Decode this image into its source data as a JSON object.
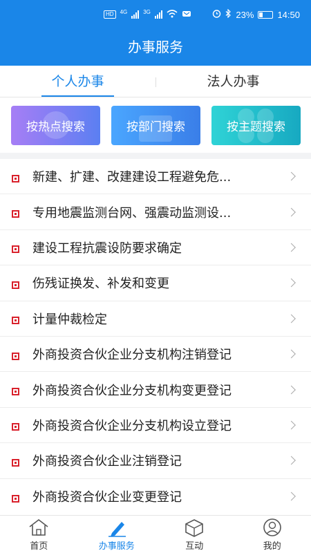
{
  "status_bar": {
    "hd_badge": "HD",
    "net_1": "4G",
    "net_2": "3G",
    "battery": "23%",
    "time": "14:50"
  },
  "header": {
    "title": "办事服务"
  },
  "tabs": [
    {
      "label": "个人办事",
      "active": true
    },
    {
      "label": "法人办事",
      "active": false
    }
  ],
  "search_buttons": {
    "hot": "按热点搜索",
    "dept": "按部门搜索",
    "topic": "按主题搜索"
  },
  "items": [
    "新建、扩建、改建建设工程避免危...",
    "专用地震监测台网、强震动监测设...",
    "建设工程抗震设防要求确定",
    "伤残证换发、补发和变更",
    "计量仲裁检定",
    "外商投资合伙企业分支机构注销登记",
    "外商投资合伙企业分支机构变更登记",
    "外商投资合伙企业分支机构设立登记",
    "外商投资合伙企业注销登记",
    "外商投资合伙企业变更登记"
  ],
  "nav": [
    {
      "label": "首页",
      "icon": "home-icon"
    },
    {
      "label": "办事服务",
      "icon": "pen-icon",
      "active": true
    },
    {
      "label": "互动",
      "icon": "cube-icon"
    },
    {
      "label": "我的",
      "icon": "user-icon"
    }
  ],
  "colors": {
    "primary": "#1a86e8",
    "bullet": "#d9212c"
  }
}
